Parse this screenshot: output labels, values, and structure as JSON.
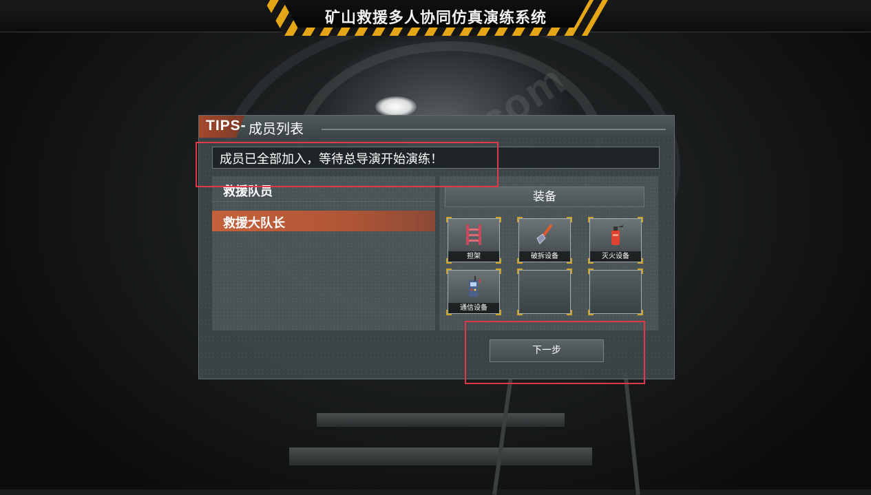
{
  "header": {
    "title": "矿山救援多人协同仿真演练系统"
  },
  "dialog": {
    "tag": "TIPS-",
    "title": "成员列表",
    "status": "成员已全部加入，等待总导演开始演练！",
    "members": {
      "heading": "救援队员",
      "items": [
        "救援大队长"
      ]
    },
    "equipment": {
      "heading": "装备",
      "slots": [
        {
          "label": "担架",
          "icon": "stretcher-icon"
        },
        {
          "label": "破拆设备",
          "icon": "demolition-shovel-icon"
        },
        {
          "label": "灭火设备",
          "icon": "fire-extinguisher-icon"
        },
        {
          "label": "通信设备",
          "icon": "radio-icon"
        },
        {
          "label": "",
          "icon": ""
        },
        {
          "label": "",
          "icon": ""
        }
      ]
    },
    "next_label": "下一步"
  },
  "watermark": "www.souvr.com",
  "colors": {
    "accent": "#c4613c",
    "hazard_yellow": "#e4a617",
    "highlight_red": "#e0394a"
  }
}
